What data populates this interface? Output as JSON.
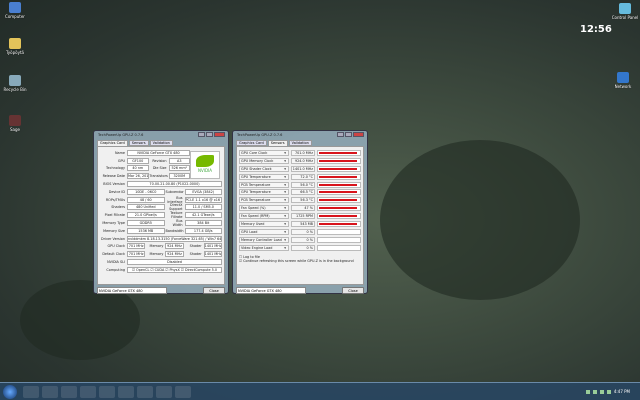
{
  "desktop": {
    "icons": [
      {
        "label": "Computer"
      },
      {
        "label": "Työpöytä"
      },
      {
        "label": "Recycle Bin"
      },
      {
        "label": "Sage"
      },
      {
        "label": "Control Panel"
      },
      {
        "label": "Network"
      }
    ],
    "clock": "12:56"
  },
  "gpuz_card": {
    "title": "TechPowerUp GPU-Z 0.7.6",
    "tabs": [
      "Graphics Card",
      "Sensors",
      "Validation"
    ],
    "active_tab": "Graphics Card",
    "logo": "NVIDIA",
    "rows": [
      [
        [
          "Name",
          "NVIDIA GeForce GTX 480"
        ]
      ],
      [
        [
          "GPU",
          "GF100"
        ],
        [
          "Revision",
          "A3"
        ]
      ],
      [
        [
          "Technology",
          "40 nm"
        ],
        [
          "Die Size",
          "526 mm²"
        ]
      ],
      [
        [
          "Release Date",
          "Mar 26, 2010"
        ],
        [
          "Transistors",
          "3200M"
        ]
      ],
      [
        [
          "BIOS Version",
          "70.00.21.00.80 (P1022-0000)"
        ]
      ],
      [
        [
          "Device ID",
          "10DE - 06C0"
        ],
        [
          "Subvendor",
          "EVGA (3842)"
        ]
      ],
      [
        [
          "ROPs/TMUs",
          "48 / 60"
        ],
        [
          "Bus Interface",
          "PCI-E 1.1 x16 @ x16 1.1"
        ]
      ],
      [
        [
          "Shaders",
          "480 Unified"
        ],
        [
          "DirectX Support",
          "11.0 / SM5.0"
        ]
      ],
      [
        [
          "Pixel Fillrate",
          "21.0 GPixel/s"
        ],
        [
          "Texture Fillrate",
          "42.1 GTexel/s"
        ]
      ],
      [
        [
          "Memory Type",
          "GDDR5"
        ],
        [
          "Bus Width",
          "384 Bit"
        ]
      ],
      [
        [
          "Memory Size",
          "1536 MB"
        ],
        [
          "Bandwidth",
          "177.4 GB/s"
        ]
      ],
      [
        [
          "Driver Version",
          "nvlddmkm 8.18.13.3150 (ForceWare 321.65) / Win7 64"
        ]
      ],
      [
        [
          "GPU Clock",
          "701 MHz"
        ],
        [
          "Memory",
          "924 MHz"
        ],
        [
          "Shader",
          "1401 MHz"
        ]
      ],
      [
        [
          "Default Clock",
          "701 MHz"
        ],
        [
          "Memory",
          "924 MHz"
        ],
        [
          "Shader",
          "1401 MHz"
        ]
      ],
      [
        [
          "NVIDIA SLI",
          "Disabled"
        ]
      ],
      [
        [
          "Computing",
          "☑ OpenCL  ☑ CUDA  ☑ PhysX  ☑ DirectCompute 5.0"
        ]
      ]
    ],
    "gpu_select": "NVIDIA GeForce GTX 480",
    "close": "Close"
  },
  "gpuz_sensors": {
    "title": "TechPowerUp GPU-Z 0.7.6",
    "tabs": [
      "Graphics Card",
      "Sensors",
      "Validation"
    ],
    "active_tab": "Sensors",
    "sensors": [
      {
        "name": "GPU Core Clock",
        "value": "701.0 MHz",
        "level": 0.95
      },
      {
        "name": "GPU Memory Clock",
        "value": "924.0 MHz",
        "level": 0.95
      },
      {
        "name": "GPU Shader Clock",
        "value": "1401.0 MHz",
        "level": 0.95
      },
      {
        "name": "GPU Temperature",
        "value": "72.0 °C",
        "level": 0.95
      },
      {
        "name": "PCB Temperature",
        "value": "56.0 °C",
        "level": 0.95
      },
      {
        "name": "GPU Temperature",
        "value": "66.5 °C",
        "level": 0.95
      },
      {
        "name": "PCB Temperature",
        "value": "56.3 °C",
        "level": 0.95
      },
      {
        "name": "Fan Speed (%)",
        "value": "47 %",
        "level": 0.95
      },
      {
        "name": "Fan Speed (RPM)",
        "value": "1725 RPM",
        "level": 0.95
      },
      {
        "name": "Memory Used",
        "value": "543 MB",
        "level": 0.95
      },
      {
        "name": "GPU Load",
        "value": "0 %",
        "level": 0
      },
      {
        "name": "Memory Controller Load",
        "value": "0 %",
        "level": 0
      },
      {
        "name": "Video Engine Load",
        "value": "0 %",
        "level": 0
      }
    ],
    "log_to_file": "Log to file",
    "continue_refresh": "Continue refreshing this screen while GPU-Z is in the background",
    "gpu_select": "NVIDIA GeForce GTX 480",
    "close": "Close"
  },
  "taskbar": {
    "time": "4:47 PM"
  }
}
